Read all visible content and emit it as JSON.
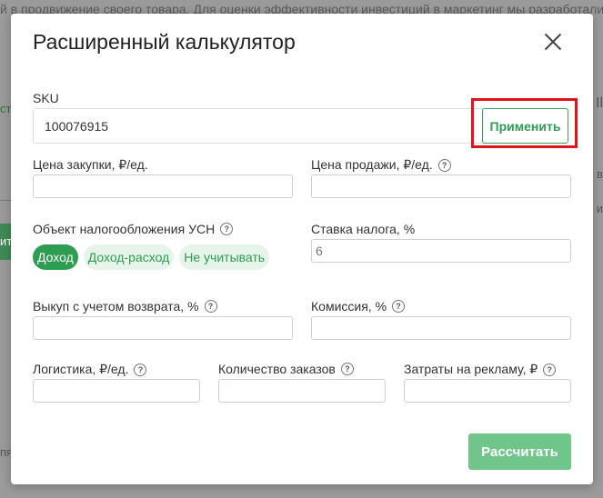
{
  "background": {
    "top_text": "й в продвижение своего товара. Для оценки эффективности инвестиций в маркетинг мы разработали",
    "left_green_text": "ст",
    "left_button_text": "ит",
    "left_bottom_text": "пя",
    "right_text_1": "Il",
    "right_text_2": "в",
    "right_text_3": "и"
  },
  "modal": {
    "title": "Расширенный калькулятор",
    "sku": {
      "label": "SKU",
      "value": "100076915"
    },
    "apply_label": "Применить",
    "purchase_price": {
      "label": "Цена закупки, ₽/ед.",
      "value": ""
    },
    "sale_price": {
      "label": "Цена продажи, ₽/ед.",
      "value": ""
    },
    "tax_object": {
      "label": "Объект налогообложения УСН",
      "options": [
        "Доход",
        "Доход-расход",
        "Не учитывать"
      ],
      "selected": "Доход"
    },
    "tax_rate": {
      "label": "Ставка налога, %",
      "placeholder": "6"
    },
    "buyout": {
      "label": "Выкуп с учетом возврата, %",
      "value": ""
    },
    "commission": {
      "label": "Комиссия, %",
      "value": ""
    },
    "logistics": {
      "label": "Логистика, ₽/ед.",
      "value": ""
    },
    "orders": {
      "label": "Количество заказов",
      "value": ""
    },
    "ad_costs": {
      "label": "Затраты на рекламу, ₽",
      "value": ""
    },
    "calculate_label": "Рассчитать",
    "help_glyph": "?"
  },
  "colors": {
    "accent": "#2e9d52",
    "accent_light": "#e6f4ea",
    "calc_button": "#6fc58a",
    "highlight": "#e0141c"
  }
}
